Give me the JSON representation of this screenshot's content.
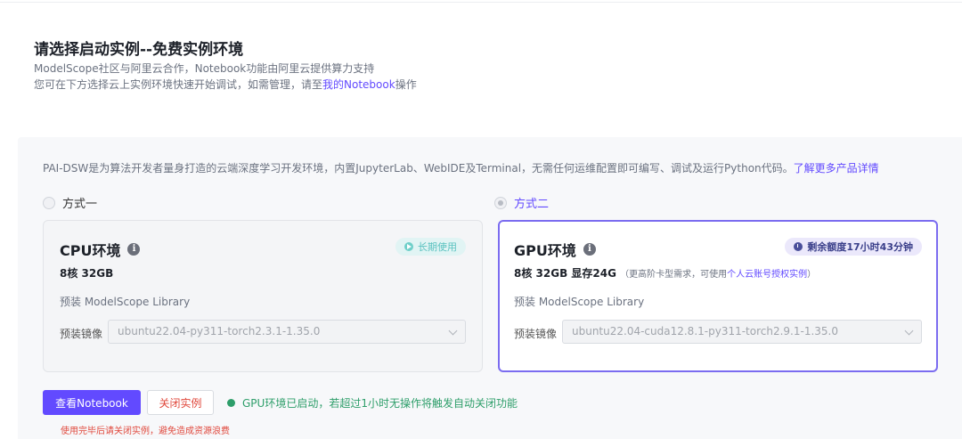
{
  "header": {
    "title": "请选择启动实例--免费实例环境",
    "line1": "ModelScope社区与阿里云合作，Notebook功能由阿里云提供算力支持",
    "line2_prefix": "您可在下方选择云上实例环境快速开始调试，如需管理，请至",
    "line2_link": "我的Notebook",
    "line2_suffix": "操作"
  },
  "panel": {
    "intro_text": "PAI-DSW是为算法开发者量身打造的云端深度学习开发环境，内置JupyterLab、WebIDE及Terminal，无需任何运维配置即可编写、调试及运行Python代码。",
    "intro_link": "了解更多产品详情",
    "option1": {
      "label": "方式一",
      "checked": false
    },
    "option2": {
      "label": "方式二",
      "checked": true
    }
  },
  "cpu_card": {
    "title": "CPU环境",
    "badge": "长期使用",
    "spec": "8核 32GB",
    "library": "预装 ModelScope Library",
    "image_label": "预装镜像",
    "image_value": "ubuntu22.04-py311-torch2.3.1-1.35.0"
  },
  "gpu_card": {
    "title": "GPU环境",
    "badge": "剩余额度17小时43分钟",
    "spec": "8核 32GB 显存24G",
    "spec_note_prefix": "（更高阶卡型需求，可使用",
    "spec_note_link": "个人云账号授权实例",
    "spec_note_suffix": "）",
    "library": "预装 ModelScope Library",
    "image_label": "预装镜像",
    "image_value": "ubuntu22.04-cuda12.8.1-py311-torch2.9.1-1.35.0"
  },
  "actions": {
    "view_notebook": "查看Notebook",
    "close_instance": "关闭实例",
    "status": "GPU环境已启动，若超过1小时无操作将触发自动关闭功能",
    "warning": "使用完毕后请关闭实例，避免造成资源浪费"
  },
  "colors": {
    "accent": "#624aff",
    "danger": "#e0493d",
    "success": "#2e9e6a",
    "teal_badge": "#5bc2c0"
  },
  "icons": {
    "info": "info-icon",
    "play": "play-circle-icon",
    "clock": "clock-icon",
    "chevron": "chevron-down-icon",
    "status": "status-dot-icon"
  }
}
